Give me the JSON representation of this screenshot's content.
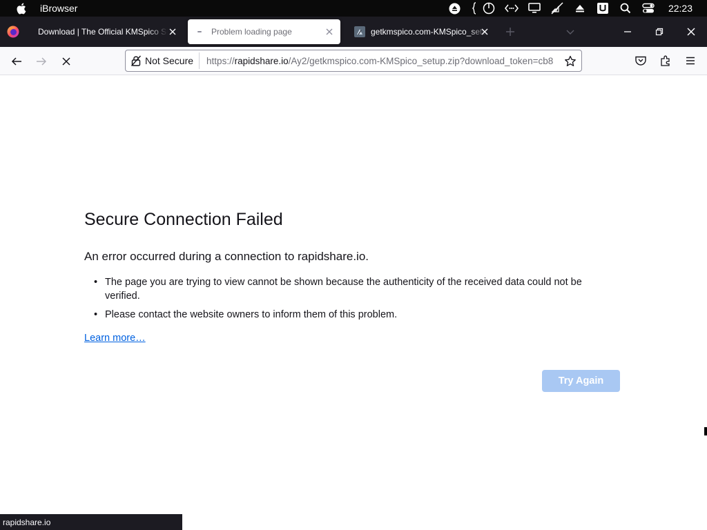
{
  "menubar": {
    "app_name": "iBrowser",
    "clock": "22:23"
  },
  "tabs": [
    {
      "title": "Download | The Official KMSpico Site",
      "active": false
    },
    {
      "title": "Problem loading page",
      "active": true
    },
    {
      "title": "getkmspico.com-KMSpico_setup.zip",
      "active": false
    }
  ],
  "toolbar": {
    "security_label": "Not Secure",
    "url_scheme": "https://",
    "url_host": "rapidshare.io",
    "url_path": "/Ay2/getkmspico.com-KMSpico_setup.zip?download_token=cb8"
  },
  "error": {
    "title": "Secure Connection Failed",
    "short_desc": "An error occurred during a connection to rapidshare.io.",
    "items": [
      "The page you are trying to view cannot be shown because the authenticity of the received data could not be verified.",
      "Please contact the website owners to inform them of this problem."
    ],
    "learn_more": "Learn more…",
    "try_again": "Try Again"
  },
  "status": {
    "text": "rapidshare.io"
  },
  "colors": {
    "tabstrip_bg": "#1c1b22",
    "link": "#0061e0",
    "primary_button_disabled": "#a9c8f3"
  }
}
